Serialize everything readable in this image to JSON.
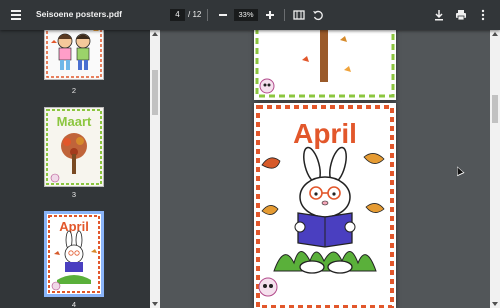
{
  "toolbar": {
    "menu_icon": "hamburger-menu-icon",
    "title": "Seisoene posters.pdf",
    "current_page": "4",
    "page_total": "/ 12",
    "zoom": "33%",
    "zoom_out_icon": "minus-icon",
    "zoom_in_icon": "plus-icon",
    "fit_icon": "fit-to-page-icon",
    "rotate_icon": "rotate-counterclockwise-icon",
    "download_icon": "download-icon",
    "print_icon": "print-icon",
    "more_icon": "more-vertical-icon"
  },
  "sidebar": {
    "thumbnails": [
      {
        "label": "2",
        "selected": false
      },
      {
        "label": "3",
        "selected": false,
        "text": "Maart"
      },
      {
        "label": "4",
        "selected": true,
        "text": "April"
      }
    ]
  },
  "viewer": {
    "page_heading": "April",
    "colors": {
      "toolbar": "#323639",
      "viewer_bg": "#525659",
      "heading": "#e2572b",
      "stripe_red": "#e2572b",
      "stripe_green": "#8cc63f",
      "selected_thumb_border": "#8ab4f8"
    }
  }
}
